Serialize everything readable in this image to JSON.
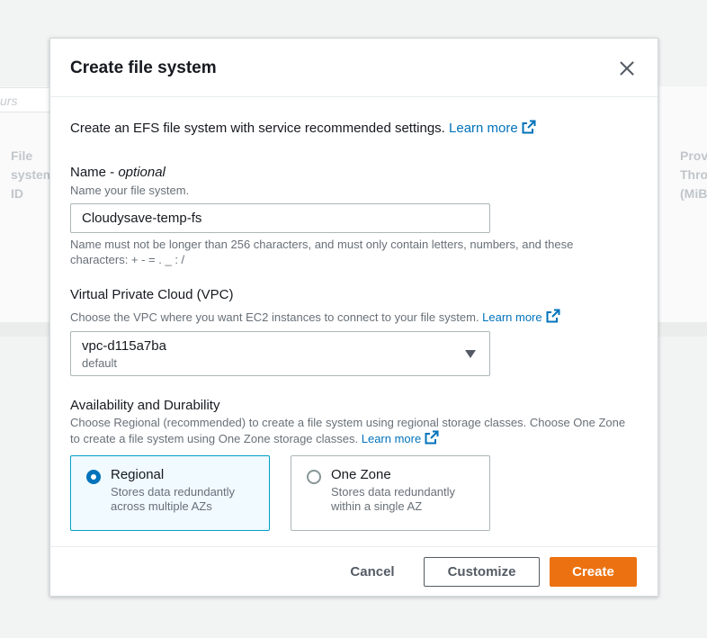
{
  "background": {
    "filter_placeholder": "urs",
    "col_left": "File system ID",
    "col_right": "Prov Thro (MiB"
  },
  "modal": {
    "title": "Create file system",
    "intro_text": "Create an EFS file system with service recommended settings.",
    "intro_link": "Learn more",
    "name": {
      "label": "Name - ",
      "label_optional": "optional",
      "description": "Name your file system.",
      "value": "Cloudysave-temp-fs",
      "constraint": "Name must not be longer than 256 characters, and must only contain letters, numbers, and these characters: + - = . _ : /"
    },
    "vpc": {
      "label": "Virtual Private Cloud (VPC)",
      "description": "Choose the VPC where you want EC2 instances to connect to your file system.",
      "link": "Learn more",
      "selected_value": "vpc-d115a7ba",
      "selected_sub": "default"
    },
    "availability": {
      "label": "Availability and Durability",
      "description": "Choose Regional (recommended) to create a file system using regional storage classes. Choose One Zone to create a file system using One Zone storage classes.",
      "link": "Learn more",
      "options": [
        {
          "title": "Regional",
          "description": "Stores data redundantly across multiple AZs",
          "selected": true
        },
        {
          "title": "One Zone",
          "description": "Stores data redundantly within a single AZ",
          "selected": false
        }
      ]
    },
    "buttons": {
      "cancel": "Cancel",
      "customize": "Customize",
      "create": "Create"
    }
  },
  "colors": {
    "link": "#0073bb",
    "primary_button": "#ec7211",
    "selected_tile_border": "#00a1c9",
    "selected_tile_bg": "#f1faff"
  },
  "icons": {
    "close": "close-icon",
    "external_link": "external-link-icon",
    "dropdown": "caret-down-icon"
  }
}
